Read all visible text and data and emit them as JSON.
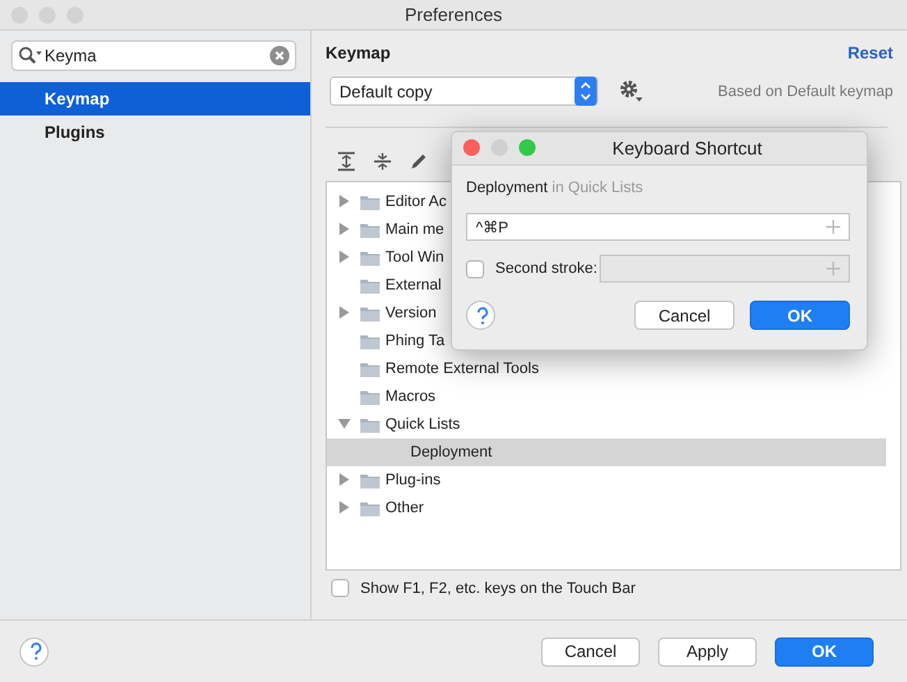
{
  "window": {
    "title": "Preferences"
  },
  "search": {
    "value": "Keyma"
  },
  "sidebar": {
    "items": [
      {
        "label": "Keymap",
        "selected": true
      },
      {
        "label": "Plugins",
        "selected": false
      }
    ]
  },
  "keymap": {
    "heading": "Keymap",
    "reset": "Reset",
    "scheme": "Default copy",
    "based_on": "Based on Default keymap"
  },
  "tree": [
    {
      "label": "Editor Ac",
      "kind": "group",
      "expanded": false,
      "selected": false
    },
    {
      "label": "Main me",
      "kind": "group",
      "expanded": false,
      "selected": false
    },
    {
      "label": "Tool Win",
      "kind": "group",
      "expanded": false,
      "selected": false
    },
    {
      "label": "External",
      "kind": "leaf",
      "selected": false
    },
    {
      "label": "Version",
      "kind": "group",
      "expanded": false,
      "selected": false
    },
    {
      "label": "Phing Ta",
      "kind": "leaf",
      "selected": false
    },
    {
      "label": "Remote External Tools",
      "kind": "leaf",
      "selected": false
    },
    {
      "label": "Macros",
      "kind": "leaf",
      "selected": false
    },
    {
      "label": "Quick Lists",
      "kind": "group",
      "expanded": true,
      "selected": false,
      "children": [
        {
          "label": "Deployment",
          "selected": true
        }
      ]
    },
    {
      "label": "Plug-ins",
      "kind": "group",
      "expanded": false,
      "selected": false
    },
    {
      "label": "Other",
      "kind": "group",
      "expanded": false,
      "selected": false
    }
  ],
  "touch_bar": {
    "label": "Show F1, F2, etc. keys on the Touch Bar",
    "checked": false
  },
  "buttons": [
    {
      "label": "Cancel",
      "default": false
    },
    {
      "label": "Apply",
      "default": false
    },
    {
      "label": "OK",
      "default": true
    }
  ],
  "dialog": {
    "title": "Keyboard Shortcut",
    "action": "Deployment",
    "context": "in Quick Lists",
    "shortcut": "^⌘P",
    "second_stroke": {
      "label": "Second stroke:",
      "checked": false
    },
    "buttons": [
      {
        "label": "Cancel",
        "default": false
      },
      {
        "label": "OK",
        "default": true
      }
    ]
  }
}
